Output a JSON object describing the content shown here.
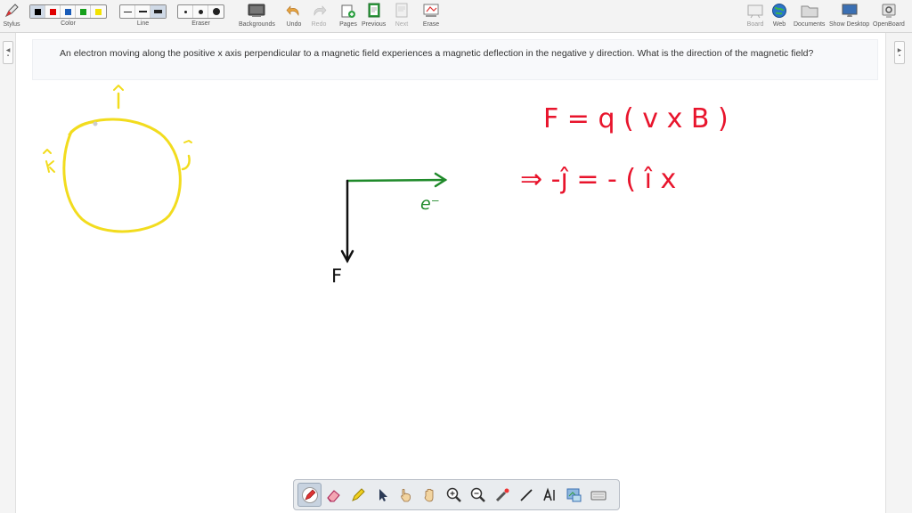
{
  "toolbar": {
    "stylus_label": "Stylus",
    "color_label": "Color",
    "line_label": "Line",
    "eraser_label": "Eraser",
    "backgrounds_label": "Backgrounds",
    "undo_label": "Undo",
    "redo_label": "Redo",
    "pages_label": "Pages",
    "previous_label": "Previous",
    "next_label": "Next",
    "erase_label": "Erase",
    "board_label": "Board",
    "web_label": "Web",
    "documents_label": "Documents",
    "show_desktop_label": "Show Desktop",
    "openboard_label": "OpenBoard",
    "colors": [
      "#000000",
      "#e00000",
      "#1a5cb8",
      "#16a01c",
      "#f2e200"
    ],
    "selected_color_index": 0
  },
  "question": {
    "text": "An electron moving along the positive x axis perpendicular to a magnetic field experiences a magnetic deflection in the negative y direction. What is the direction of the magnetic field?"
  },
  "sketch": {
    "circle_labels": {
      "top": "î",
      "right": "ĵ",
      "left": "k̂"
    },
    "electron_label": "e⁻",
    "force_label": "F",
    "equation_line1": "F =  q ( v x B )",
    "equation_line2": "⇒  -ĵ  =  -  ( î  x",
    "ink_colors": {
      "circle": "#f2dc1e",
      "electron": "#1f8a2a",
      "force": "#111111",
      "equation": "#e8142c"
    }
  },
  "bottom_tools": [
    "pen-tool",
    "eraser-tool",
    "marker-tool",
    "selector-tool",
    "play-tool",
    "hand-tool",
    "zoom-in-tool",
    "zoom-out-tool",
    "laser-pointer-tool",
    "line-tool",
    "text-tool",
    "capture-tool",
    "virtual-keyboard-tool"
  ]
}
